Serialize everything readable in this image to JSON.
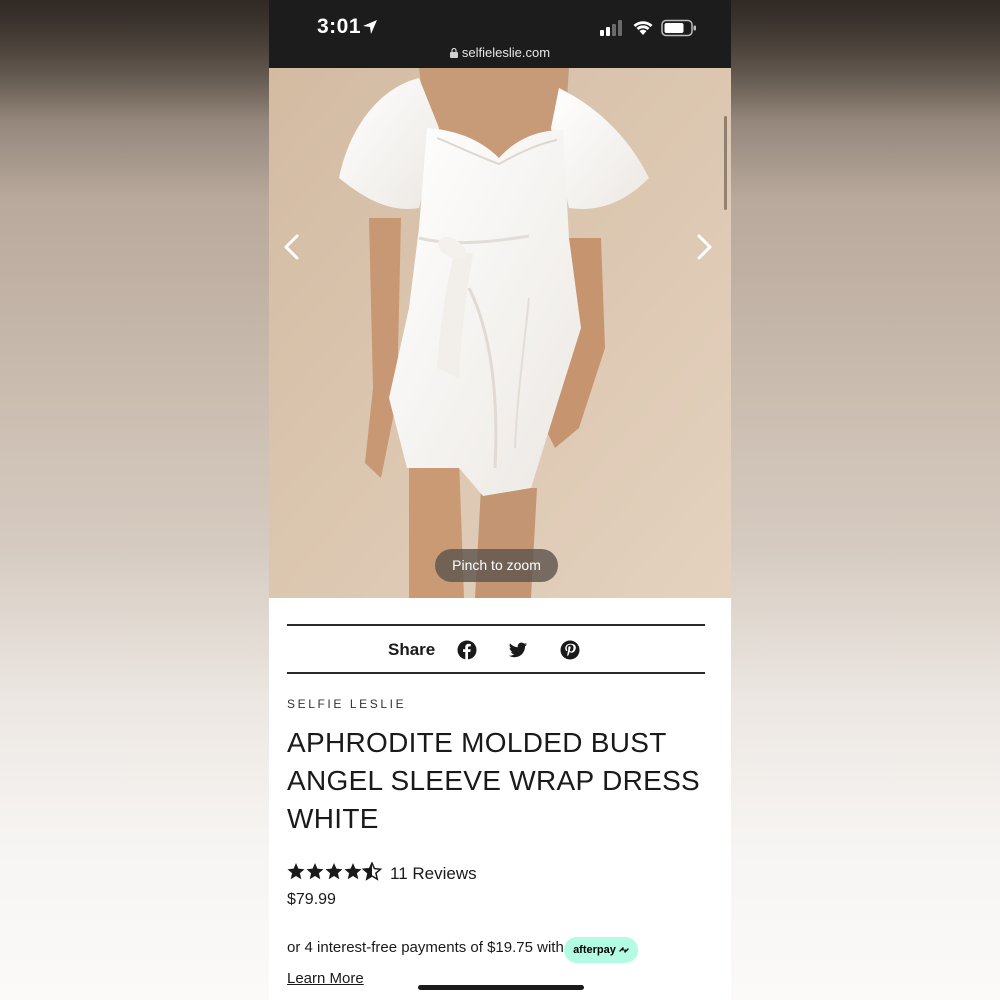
{
  "status_bar": {
    "time": "3:01",
    "url": "selfieleslie.com"
  },
  "gallery": {
    "pinch_label": "Pinch to zoom"
  },
  "share": {
    "label": "Share",
    "icons": [
      "facebook-icon",
      "twitter-icon",
      "pinterest-icon"
    ]
  },
  "product": {
    "vendor": "SELFIE LESLIE",
    "title": "APHRODITE MOLDED BUST ANGEL SLEEVE WRAP DRESS WHITE",
    "rating": 4.5,
    "reviews": "11 Reviews",
    "price": "$79.99"
  },
  "payment": {
    "installment_text": "or 4 interest-free payments of $19.75 with",
    "afterpay_label": "afterpay",
    "learn_more": "Learn More"
  },
  "colors": {
    "afterpay": "#b2fce4",
    "status_bar": "#1c1c1c",
    "text": "#1a1a1a"
  }
}
